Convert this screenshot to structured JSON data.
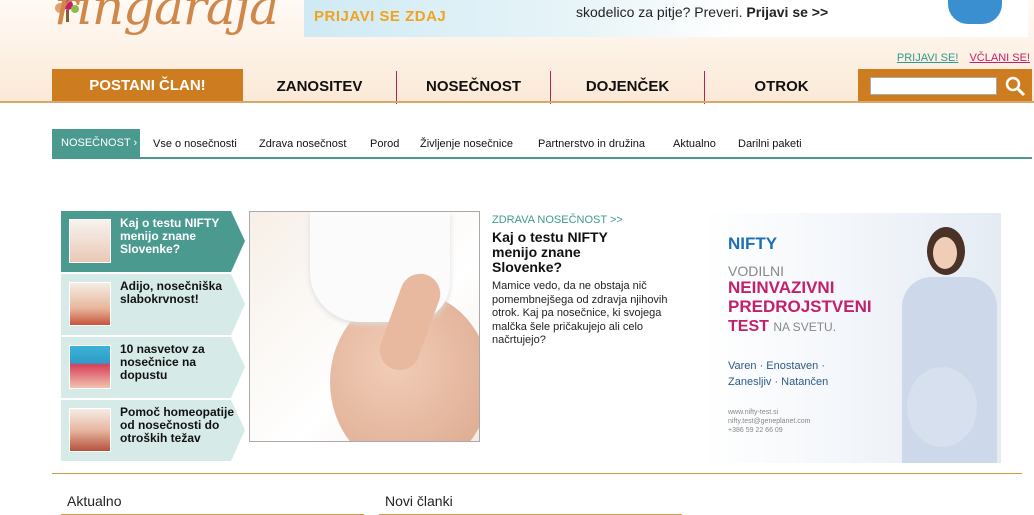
{
  "header": {
    "logo": "ringaraja",
    "banner_cta": "PRIJAVI SE ZDAJ",
    "banner_text": "skodelico za pitje? Preveri.",
    "banner_link": "Prijavi se >>",
    "login": "PRIJAVI SE!",
    "register": "VČLANI SE!"
  },
  "nav": {
    "join": "POSTANI ČLAN!",
    "items": [
      "ZANOSITEV",
      "NOSEČNOST",
      "DOJENČEK",
      "OTROK"
    ],
    "search_placeholder": ""
  },
  "subnav": {
    "active": "NOSEČNOST",
    "items": [
      "Vse o nosečnosti",
      "Zdrava nosečnost",
      "Porod",
      "Življenje nosečnice",
      "Partnerstvo in družina",
      "Aktualno",
      "Darilni paketi"
    ]
  },
  "stories": [
    {
      "title": "Kaj o testu NIFTY menijo znane Slovenke?"
    },
    {
      "title": "Adijo, nosečniška slabokrvnost!"
    },
    {
      "title": "10 nasvetov za nosečnice na dopustu"
    },
    {
      "title": "Pomoč homeopatije od nosečnosti do otroških težav"
    }
  ],
  "article": {
    "category": "ZDRAVA NOSEČNOST >>",
    "title": "Kaj o testu NIFTY menijo znane Slovenke?",
    "body": "Mamice vedo, da ne obstaja nič pomembnejšega od zdravja njihovih otrok. Kaj pa nosečnice, ki svojega malčka šele pričakujejo ali celo načrtujejo?"
  },
  "ad": {
    "brand": "NIFTY",
    "line1": "VODILNI",
    "line2a": "NEINVAZIVNI",
    "line2b": "PREDROJSTVENI",
    "line3": "TEST",
    "line3b": "NA SVETU.",
    "features1": "Varen · Enostaven ·",
    "features2": "Zanesljiv · Natančen",
    "contact1": "www.nifty-test.si",
    "contact2": "nifty.test@geneplanet.com",
    "contact3": "+386 59 22 66 09"
  },
  "sections": [
    "Aktualno",
    "Novi članki"
  ],
  "colors": {
    "accent_orange": "#cd7c1f",
    "teal": "#4a9a8f",
    "magenta": "#c3206b"
  }
}
